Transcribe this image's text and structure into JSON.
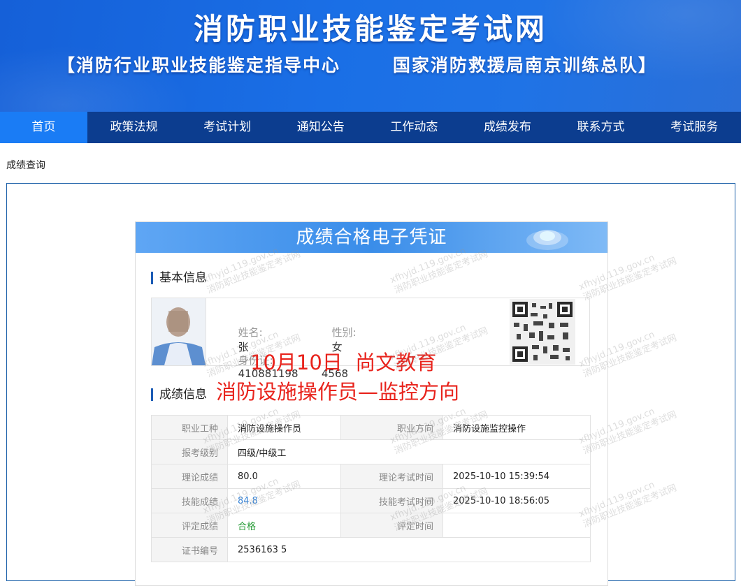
{
  "site": {
    "title": "消防职业技能鉴定考试网",
    "subtitle": "【消防行业职业技能鉴定指导中心       国家消防救援局南京训练总队】"
  },
  "nav": [
    {
      "label": "首页",
      "active": true
    },
    {
      "label": "政策法规"
    },
    {
      "label": "考试计划"
    },
    {
      "label": "通知公告"
    },
    {
      "label": "工作动态"
    },
    {
      "label": "成绩发布"
    },
    {
      "label": "联系方式"
    },
    {
      "label": "考试服务"
    }
  ],
  "breadcrumb": "成绩查询",
  "certificate": {
    "title": "成绩合格电子凭证",
    "basic_title": "基本信息",
    "name_label": "姓名:",
    "name_value": "张",
    "gender_label": "性别:",
    "gender_value": "女",
    "id_label": "身份证:",
    "id_value": "410881198       4568",
    "score_title": "成绩信息"
  },
  "overlay": {
    "line1": "10月10日  尚文教育",
    "line2": "消防设施操作员—监控方向"
  },
  "scores": {
    "occupation_label": "职业工种",
    "occupation_value": "消防设施操作员",
    "direction_label": "职业方向",
    "direction_value": "消防设施监控操作",
    "level_label": "报考级别",
    "level_value": "四级/中级工",
    "theory_label": "理论成绩",
    "theory_value": "80.0",
    "theory_time_label": "理论考试时间",
    "theory_time_value": "2025-10-10 15:39:54",
    "skill_label": "技能成绩",
    "skill_value": "84.8",
    "skill_time_label": "技能考试时间",
    "skill_time_value": "2025-10-10 18:56:05",
    "eval_label": "评定成绩",
    "eval_value": "合格",
    "eval_time_label": "评定时间",
    "eval_time_value": "",
    "cert_label": "证书编号",
    "cert_value": "2536163         5"
  },
  "watermark": {
    "line1": "xfhyjd.119.gov.cn",
    "line2": "消防职业技能鉴定考试网"
  },
  "colors": {
    "nav_bg": "#0c3d8f",
    "nav_active": "#1a7cf5",
    "overlay_red": "#e8231c",
    "pass_green": "#2a9d3a",
    "skill_blue": "#3a86d8"
  }
}
